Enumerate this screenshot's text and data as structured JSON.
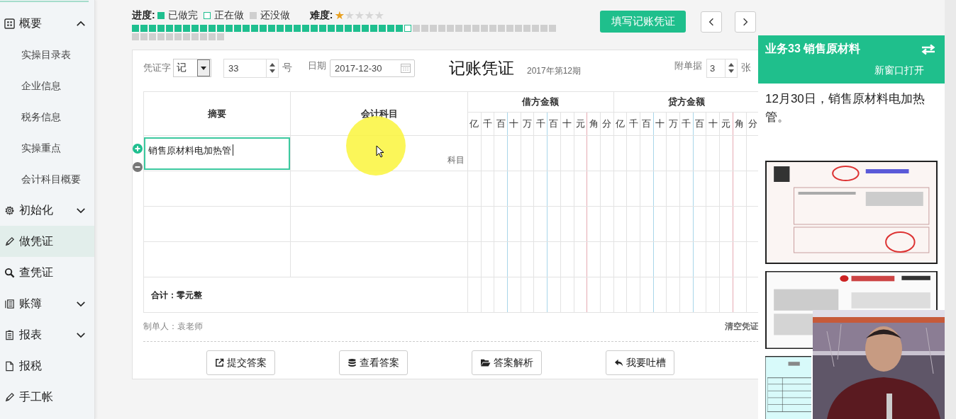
{
  "sidebar": {
    "items": [
      {
        "label": "概要",
        "kind": "group",
        "expanded": true,
        "selected": false,
        "children": [
          {
            "label": "实操目录表",
            "selected": false
          },
          {
            "label": "企业信息",
            "selected": false
          },
          {
            "label": "税务信息",
            "selected": false
          },
          {
            "label": "实操重点",
            "selected": false
          },
          {
            "label": "会计科目概要",
            "selected": false
          }
        ]
      },
      {
        "label": "初始化",
        "kind": "group",
        "expanded": false,
        "selected": false
      },
      {
        "label": "做凭证",
        "kind": "link",
        "selected": true
      },
      {
        "label": "查凭证",
        "kind": "link",
        "selected": false
      },
      {
        "label": "账簿",
        "kind": "group",
        "expanded": false,
        "selected": false
      },
      {
        "label": "报表",
        "kind": "group",
        "expanded": false,
        "selected": false
      },
      {
        "label": "报税",
        "kind": "link",
        "selected": false
      },
      {
        "label": "手工帐",
        "kind": "link",
        "selected": false
      }
    ]
  },
  "progress": {
    "label": "进度:",
    "legend": [
      {
        "label": "已做完",
        "kind": "done"
      },
      {
        "label": "正在做",
        "kind": "current"
      },
      {
        "label": "还没做",
        "kind": "todo"
      }
    ],
    "cells": [
      {
        "kind": "done"
      },
      {
        "kind": "done"
      },
      {
        "kind": "done"
      },
      {
        "kind": "done"
      },
      {
        "kind": "done"
      },
      {
        "kind": "done"
      },
      {
        "kind": "done"
      },
      {
        "kind": "done"
      },
      {
        "kind": "done"
      },
      {
        "kind": "done"
      },
      {
        "kind": "done"
      },
      {
        "kind": "done"
      },
      {
        "kind": "done"
      },
      {
        "kind": "done"
      },
      {
        "kind": "done"
      },
      {
        "kind": "done"
      },
      {
        "kind": "done"
      },
      {
        "kind": "done"
      },
      {
        "kind": "done"
      },
      {
        "kind": "done"
      },
      {
        "kind": "done"
      },
      {
        "kind": "done"
      },
      {
        "kind": "done"
      },
      {
        "kind": "done"
      },
      {
        "kind": "done"
      },
      {
        "kind": "done"
      },
      {
        "kind": "done"
      },
      {
        "kind": "done"
      },
      {
        "kind": "done"
      },
      {
        "kind": "done"
      },
      {
        "kind": "done"
      },
      {
        "kind": "done"
      },
      {
        "kind": "current"
      },
      {
        "kind": "todo"
      },
      {
        "kind": "todo"
      },
      {
        "kind": "todo"
      },
      {
        "kind": "todo"
      },
      {
        "kind": "todo"
      },
      {
        "kind": "todo"
      },
      {
        "kind": "todo"
      },
      {
        "kind": "todo"
      },
      {
        "kind": "todo"
      },
      {
        "kind": "todo"
      },
      {
        "kind": "todo"
      },
      {
        "kind": "todo"
      },
      {
        "kind": "todo"
      },
      {
        "kind": "todo"
      },
      {
        "kind": "todo"
      },
      {
        "kind": "todo"
      },
      {
        "kind": "todo"
      },
      {
        "kind": "todo"
      },
      {
        "kind": "todo"
      },
      {
        "kind": "todo"
      },
      {
        "kind": "todo"
      },
      {
        "kind": "todo"
      },
      {
        "kind": "todo"
      },
      {
        "kind": "todo"
      },
      {
        "kind": "todo"
      },
      {
        "kind": "todo"
      },
      {
        "kind": "todo"
      },
      {
        "kind": "todo"
      }
    ]
  },
  "difficulty": {
    "label": "难度:",
    "stars": 1
  },
  "toolbar": {
    "fill_button": "填写记账凭证"
  },
  "voucher": {
    "type_label": "凭证字",
    "type_value": "记",
    "number_value": "33",
    "number_suffix": "号",
    "date_label": "日期",
    "date_value": "2017-12-30",
    "title": "记账凭证",
    "period": "2017年第12期",
    "attachments_label": "附单据",
    "attachments_value": "3",
    "attachments_suffix": "张",
    "columns": {
      "summary": "摘要",
      "account": "会计科目",
      "debit": "借方金额",
      "credit": "贷方金额",
      "debit_units": [
        "亿",
        "千",
        "百",
        "十",
        "万",
        "千",
        "百",
        "十",
        "元",
        "角",
        "分"
      ],
      "credit_units": [
        "亿",
        "千",
        "百",
        "十",
        "万",
        "千",
        "百",
        "十",
        "元",
        "角",
        "分"
      ]
    },
    "rows": [
      {
        "editing": true,
        "summary": "销售原材料电加热管",
        "account_placeholder": "科目"
      },
      {
        "editing": false
      },
      {
        "editing": false
      },
      {
        "editing": false
      }
    ],
    "total": "合计：零元整",
    "preparer": "制单人：袁老师",
    "clear": "清空凭证"
  },
  "actions": [
    {
      "label": "提交答案"
    },
    {
      "label": "查看答案"
    },
    {
      "label": "答案解析"
    },
    {
      "label": "我要吐槽"
    }
  ],
  "task_panel": {
    "title": "业务33 销售原材料",
    "open_new_window": "新窗口打开",
    "description": "12月30日，销售原材料电加热管。"
  }
}
